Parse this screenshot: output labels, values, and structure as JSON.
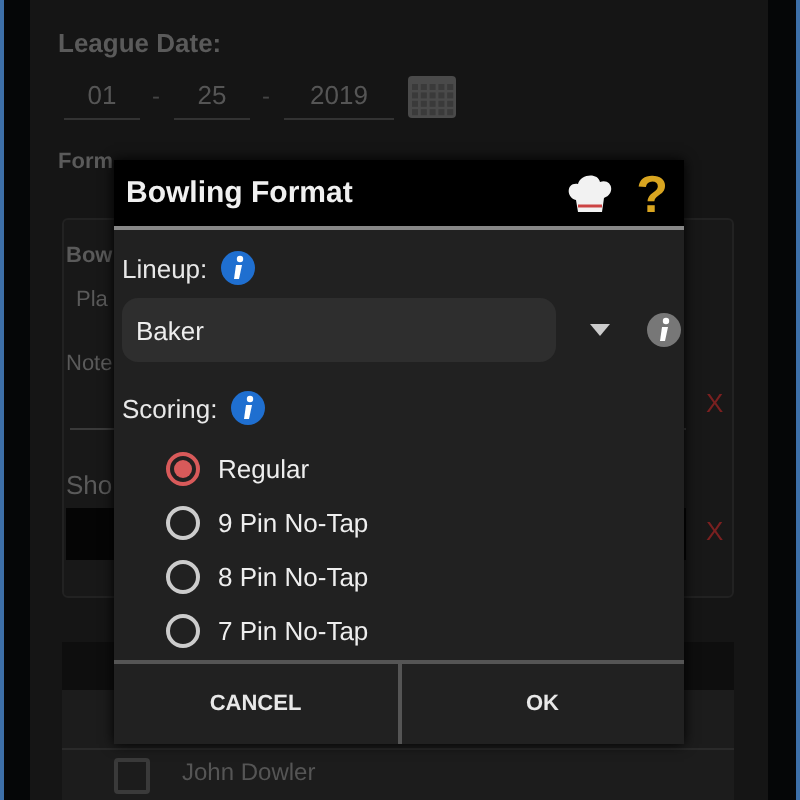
{
  "background": {
    "league_date_label": "League Date:",
    "date": {
      "month": "01",
      "separator_1": "-",
      "day": "25",
      "separator_2": "-",
      "year": "2019"
    },
    "format_label": "Form",
    "bowlers_label": "Bow",
    "bowlers_value": "Pla",
    "notes_label": "Note",
    "notes_remove": "X",
    "short_label": "Sho",
    "short_remove": "X",
    "roster": [
      {
        "name": "John Dowler",
        "checked": false
      }
    ]
  },
  "dialog": {
    "title": "Bowling Format",
    "help": "?",
    "lineup_label": "Lineup:",
    "lineup_value": "Baker",
    "scoring_label": "Scoring:",
    "scoring_options": [
      {
        "label": "Regular",
        "selected": true
      },
      {
        "label": "9 Pin No-Tap",
        "selected": false
      },
      {
        "label": "8 Pin No-Tap",
        "selected": false
      },
      {
        "label": "7 Pin No-Tap",
        "selected": false
      }
    ],
    "buttons": [
      "CANCEL",
      "OK"
    ]
  }
}
